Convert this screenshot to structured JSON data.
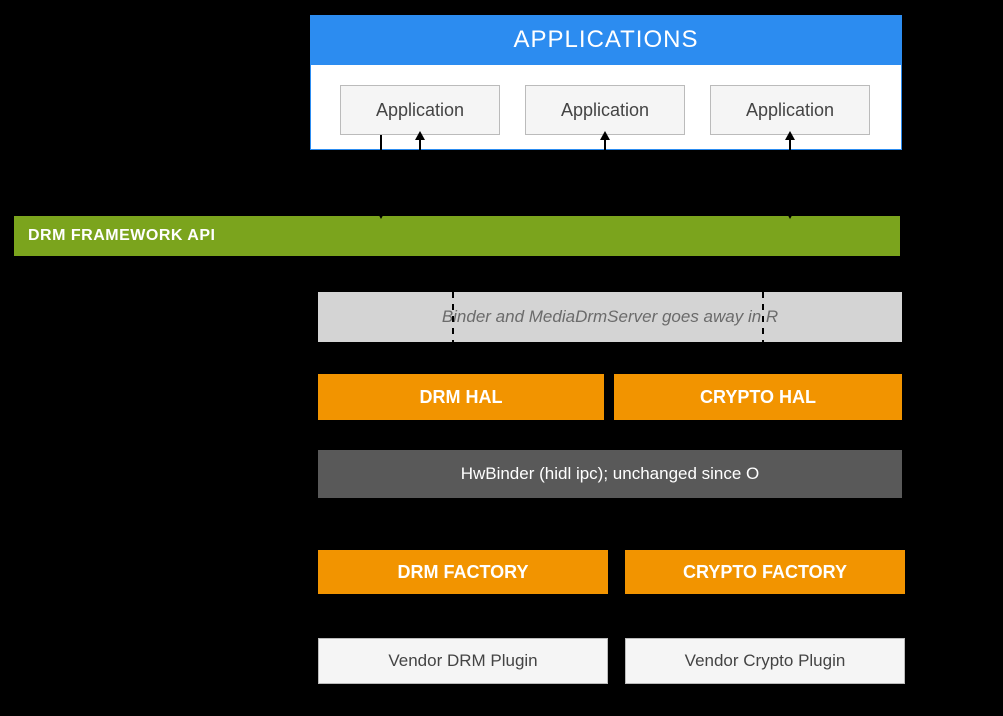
{
  "apps": {
    "header": "APPLICATIONS",
    "items": [
      "Application",
      "Application",
      "Application"
    ]
  },
  "drm_api": "DRM FRAMEWORK API",
  "binder_note": "Binder and MediaDrmServer  goes away in R",
  "hal": {
    "drm": "DRM HAL",
    "crypto": "CRYPTO HAL"
  },
  "hwbinder": "HwBinder (hidl ipc); unchanged since O",
  "factory": {
    "drm": "DRM FACTORY",
    "crypto": "CRYPTO FACTORY"
  },
  "vendor": {
    "drm": "Vendor DRM Plugin",
    "crypto": "Vendor Crypto Plugin"
  }
}
